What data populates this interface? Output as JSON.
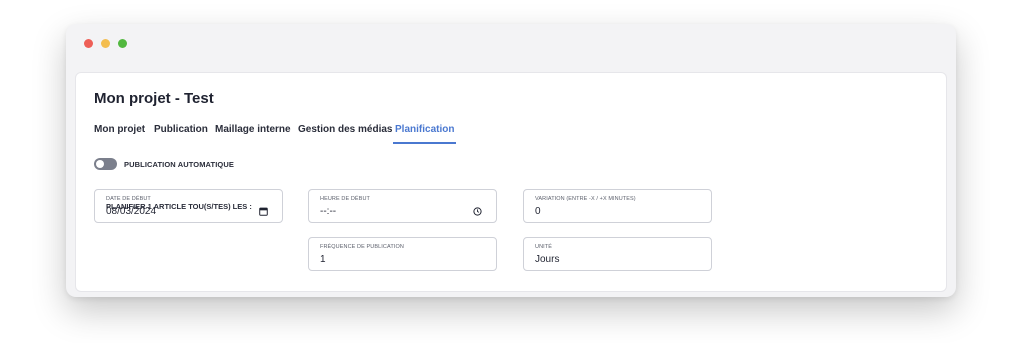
{
  "window": {
    "controls": [
      "close",
      "minimize",
      "maximize"
    ]
  },
  "header": {
    "title": "Mon projet - Test"
  },
  "tabs": [
    {
      "label": "Mon projet",
      "active": false
    },
    {
      "label": "Publication",
      "active": false
    },
    {
      "label": "Maillage interne",
      "active": false
    },
    {
      "label": "Gestion des médias",
      "active": false
    },
    {
      "label": "Planification",
      "active": true
    }
  ],
  "auto_publish": {
    "label": "PUBLICATION AUTOMATIQUE",
    "enabled": false
  },
  "fields": {
    "start_date": {
      "label": "DATE DE DÉBUT",
      "value": "08/03/2024",
      "icon": "calendar-icon"
    },
    "start_time": {
      "label": "HEURE DE DÉBUT",
      "value": "--:--",
      "icon": "clock-icon"
    },
    "variation": {
      "label": "VARIATION (ENTRE -X / +X MINUTES)",
      "value": "0"
    },
    "frequency": {
      "label": "FRÉQUENCE DE PUBLICATION",
      "value": "1"
    },
    "unit": {
      "label": "UNITÉ",
      "value": "Jours"
    }
  },
  "schedule_label": "PLANIFIER 1 ARTICLE TOU(S/TES) LES :",
  "colors": {
    "accent": "#4a78d0",
    "toggle_off": "#7b7f8c",
    "close": "#ee5f57",
    "minimize": "#f3bd4f",
    "maximize": "#52b83f"
  }
}
